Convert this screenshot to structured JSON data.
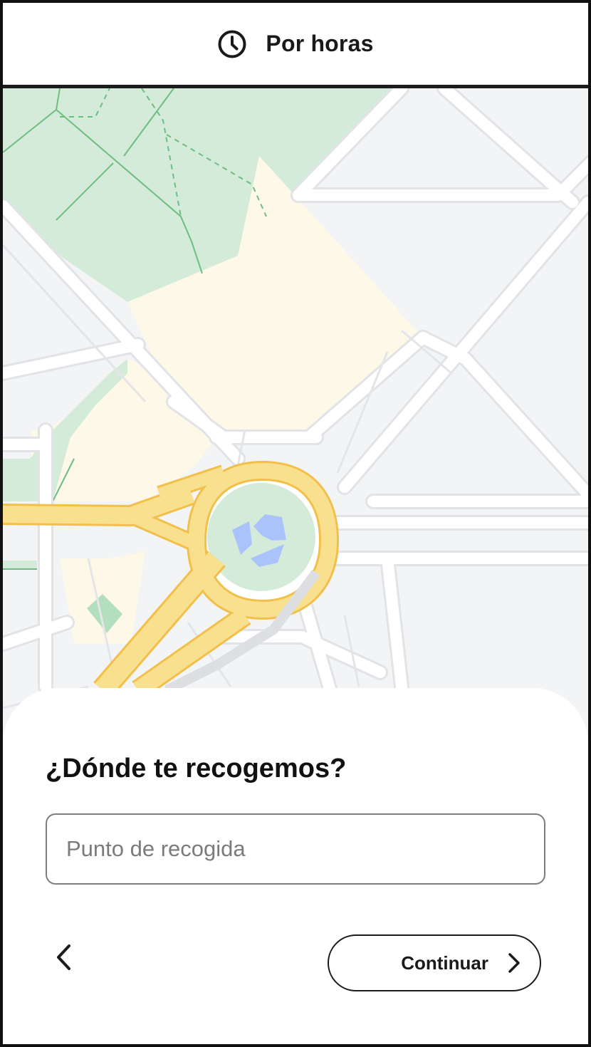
{
  "header": {
    "title": "Por horas",
    "icon": "clock-icon"
  },
  "map": {
    "colors": {
      "background": "#f3f4f6",
      "park": "#d3ebd8",
      "built_area": "#fdf8e8",
      "road": "#ffffff",
      "major_road": "#f9e08e",
      "major_road_outline": "#f2c04a",
      "water": "#aac4fb"
    }
  },
  "sheet": {
    "question": "¿Dónde te recogemos?",
    "pickup_input": {
      "value": "",
      "placeholder": "Punto de recogida"
    },
    "back_button": {
      "icon": "chevron-left-icon"
    },
    "continue_button": {
      "label": "Continuar",
      "icon": "chevron-right-icon"
    }
  }
}
